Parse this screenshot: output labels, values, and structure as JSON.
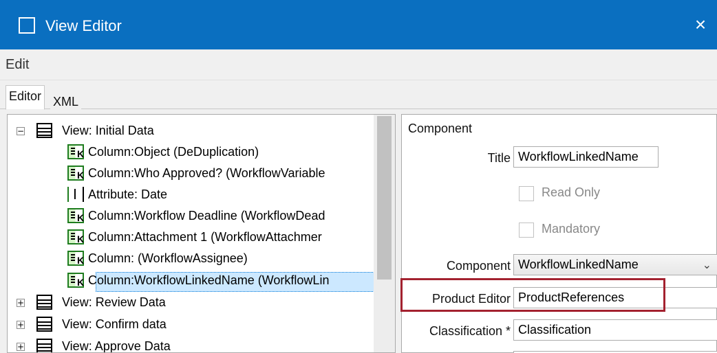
{
  "window": {
    "title": "View Editor",
    "icon_name": "window-icon",
    "close_label": "×"
  },
  "menu": {
    "edit_label": "Edit"
  },
  "tabs": [
    {
      "label": "Editor",
      "active": true
    },
    {
      "label": "XML",
      "active": false
    }
  ],
  "tree": {
    "items": [
      {
        "type": "view",
        "label": "View: Initial Data",
        "expanded": true
      },
      {
        "type": "column",
        "label": "Column:Object (DeDuplication)"
      },
      {
        "type": "column",
        "label": "Column:Who Approved? (WorkflowVariable"
      },
      {
        "type": "attribute",
        "label": "Attribute: Date"
      },
      {
        "type": "column",
        "label": "Column:Workflow Deadline (WorkflowDead"
      },
      {
        "type": "column",
        "label": "Column:Attachment 1 (WorkflowAttachmer"
      },
      {
        "type": "column",
        "label": "Column: (WorkflowAssignee)"
      },
      {
        "type": "column",
        "label": "Column:WorkflowLinkedName (WorkflowLin",
        "selected": true
      },
      {
        "type": "view",
        "label": "View: Review Data",
        "expanded": false
      },
      {
        "type": "view",
        "label": "View: Confirm data",
        "expanded": false
      },
      {
        "type": "view",
        "label": "View: Approve Data",
        "expanded": false
      }
    ]
  },
  "component_panel": {
    "section_title": "Component",
    "title_label": "Title",
    "title_value": "WorkflowLinkedName",
    "read_only_label": "Read Only",
    "mandatory_label": "Mandatory",
    "component_label": "Component",
    "component_value": "WorkflowLinkedName",
    "product_editor_label": "Product Editor",
    "product_editor_value": "ProductReferences",
    "classification_label": "Classification *",
    "classification_value": "Classification"
  },
  "colors": {
    "titlebar": "#0a6fc0",
    "selection": "#cce8ff",
    "highlight": "#a3212f"
  }
}
